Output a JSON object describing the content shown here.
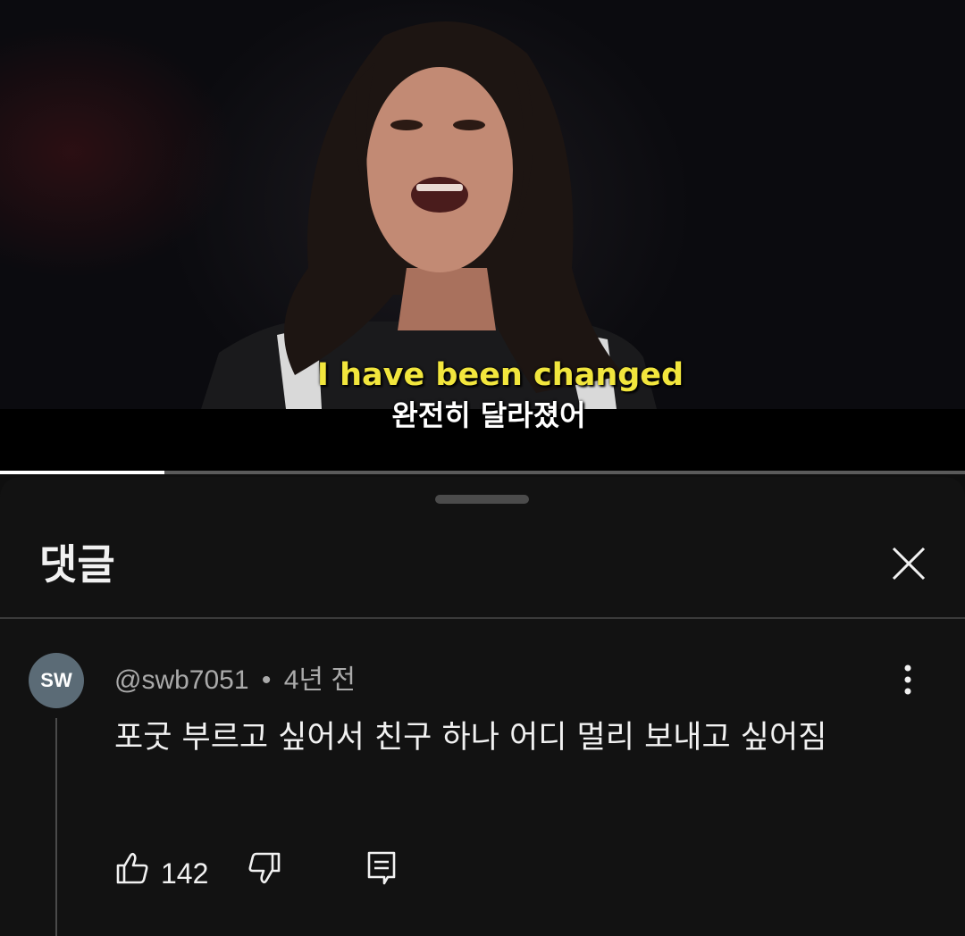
{
  "video": {
    "caption_en": "I have been changed",
    "caption_ko": "완전히 달라졌어",
    "progress": 0.17
  },
  "comments_panel": {
    "title": "댓글",
    "comment": {
      "avatar_initials": "SW",
      "author": "@swb7051",
      "separator": "•",
      "time": "4년 전",
      "text": "포굿 부르고 싶어서 친구 하나 어디 멀리 보내고 싶어짐",
      "like_count": "142"
    },
    "icons": {
      "close": "close-icon",
      "more": "more-vert-icon",
      "like": "thumb-up-icon",
      "dislike": "thumb-down-icon",
      "reply": "reply-icon"
    }
  }
}
